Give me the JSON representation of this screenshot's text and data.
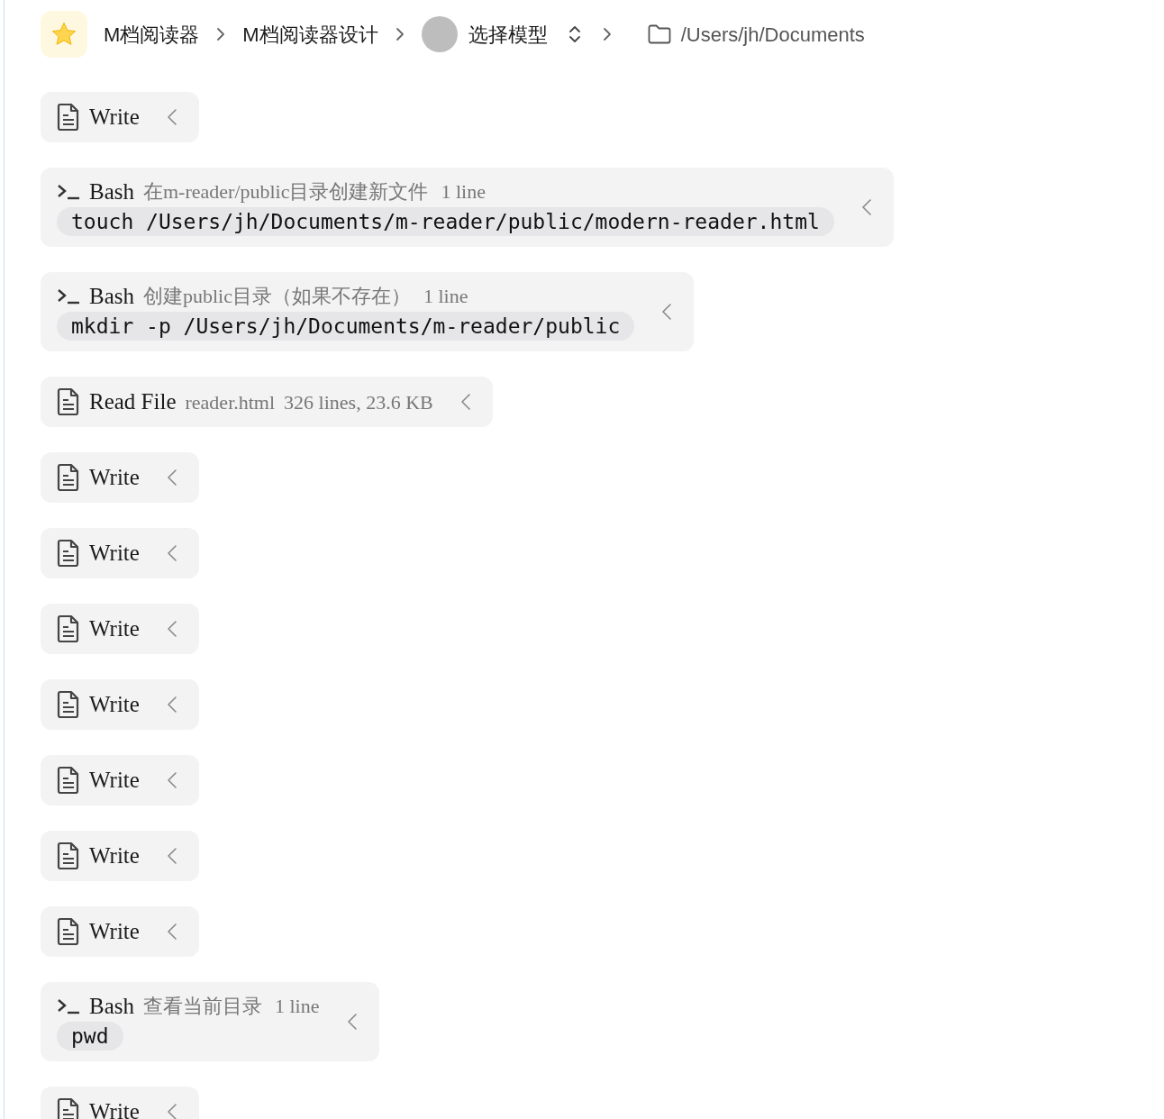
{
  "breadcrumb": {
    "items": [
      "M档阅读器",
      "M档阅读器设计"
    ],
    "model": "选择模型",
    "path": "/Users/jh/Documents"
  },
  "items": [
    {
      "kind": "file",
      "title": "Write"
    },
    {
      "kind": "bash",
      "title": "Bash",
      "description": "在m-reader/public目录创建新文件",
      "meta": "1 line",
      "command": "touch /Users/jh/Documents/m-reader/public/modern-reader.html"
    },
    {
      "kind": "bash",
      "title": "Bash",
      "description": "创建public目录（如果不存在）",
      "meta": "1 line",
      "command": "mkdir -p /Users/jh/Documents/m-reader/public"
    },
    {
      "kind": "file",
      "title": "Read File",
      "description": "reader.html",
      "meta": "326 lines, 23.6 KB"
    },
    {
      "kind": "file",
      "title": "Write"
    },
    {
      "kind": "file",
      "title": "Write"
    },
    {
      "kind": "file",
      "title": "Write"
    },
    {
      "kind": "file",
      "title": "Write"
    },
    {
      "kind": "file",
      "title": "Write"
    },
    {
      "kind": "file",
      "title": "Write"
    },
    {
      "kind": "file",
      "title": "Write"
    },
    {
      "kind": "bash",
      "title": "Bash",
      "description": "查看当前目录",
      "meta": "1 line",
      "command": "pwd"
    },
    {
      "kind": "file",
      "title": "Write"
    }
  ]
}
